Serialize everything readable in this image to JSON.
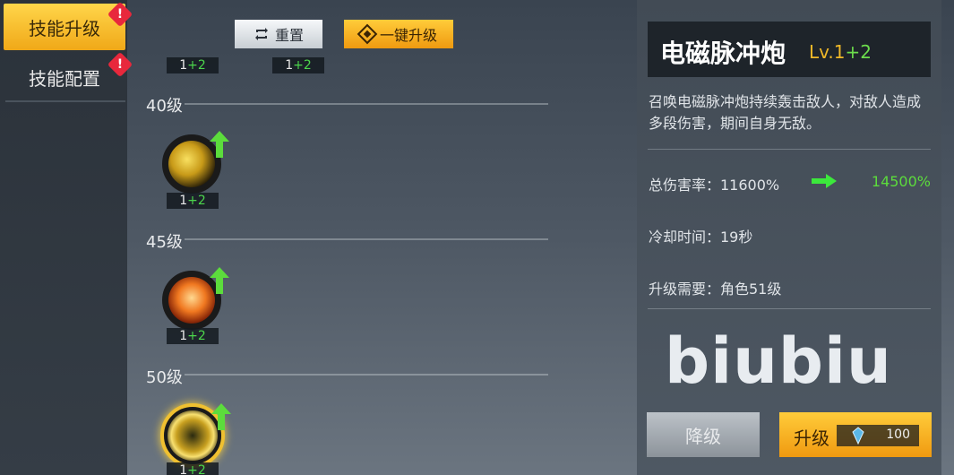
{
  "sidebar": {
    "tabs": [
      {
        "label": "技能升级",
        "active": true,
        "alert": "!"
      },
      {
        "label": "技能配置",
        "active": false,
        "alert": "!"
      }
    ]
  },
  "toolbar": {
    "reset_label": "重置",
    "upgrade_all_label": "一键升级"
  },
  "top_tags": [
    "1",
    "+2",
    "1",
    "+2"
  ],
  "tiers": [
    {
      "label": "40级",
      "tag_base": "1",
      "tag_plus": "+2"
    },
    {
      "label": "45级",
      "tag_base": "1",
      "tag_plus": "+2"
    },
    {
      "label": "50级",
      "tag_base": "1",
      "tag_plus": "+2"
    }
  ],
  "detail": {
    "skill_name": "电磁脉冲炮",
    "level_prefix": "Lv.1",
    "level_plus": "+2",
    "description": "召唤电磁脉冲炮持续轰击敌人，对敌人造成多段伤害，期间自身无敌。",
    "damage_label": "总伤害率：11600%",
    "damage_new": "14500%",
    "cooldown_label": "冷却时间：19秒",
    "requirement_label": "升级需要：角色51级",
    "watermark": "biubiu",
    "downgrade_label": "降级",
    "upgrade_label": "升级",
    "upgrade_cost": "100"
  },
  "colors": {
    "accent_gold": "#f0b828",
    "green": "#5cdc3c",
    "alert_red": "#e8283c"
  }
}
